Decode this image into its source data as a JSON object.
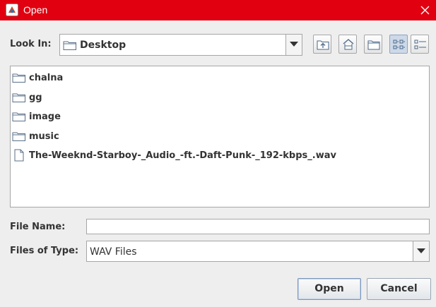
{
  "window": {
    "title": "Open",
    "title_bar_color": "#e00010"
  },
  "look_in": {
    "label": "Look In:",
    "value": "Desktop"
  },
  "toolbar": {
    "up_icon": "up-one-level-icon",
    "home_icon": "home-icon",
    "new_folder_icon": "new-folder-icon",
    "list_view_icon": "list-view-icon",
    "details_view_icon": "details-view-icon"
  },
  "files": [
    {
      "name": "chalna",
      "type": "folder"
    },
    {
      "name": "gg",
      "type": "folder"
    },
    {
      "name": "image",
      "type": "folder"
    },
    {
      "name": "music",
      "type": "folder"
    },
    {
      "name": "The-Weeknd-Starboy-_Audio_-ft.-Daft-Punk-_192-kbps_.wav",
      "type": "file"
    }
  ],
  "file_name": {
    "label": "File Name:",
    "value": ""
  },
  "files_of_type": {
    "label": "Files of Type:",
    "value": "WAV Files"
  },
  "buttons": {
    "open": "Open",
    "cancel": "Cancel"
  }
}
